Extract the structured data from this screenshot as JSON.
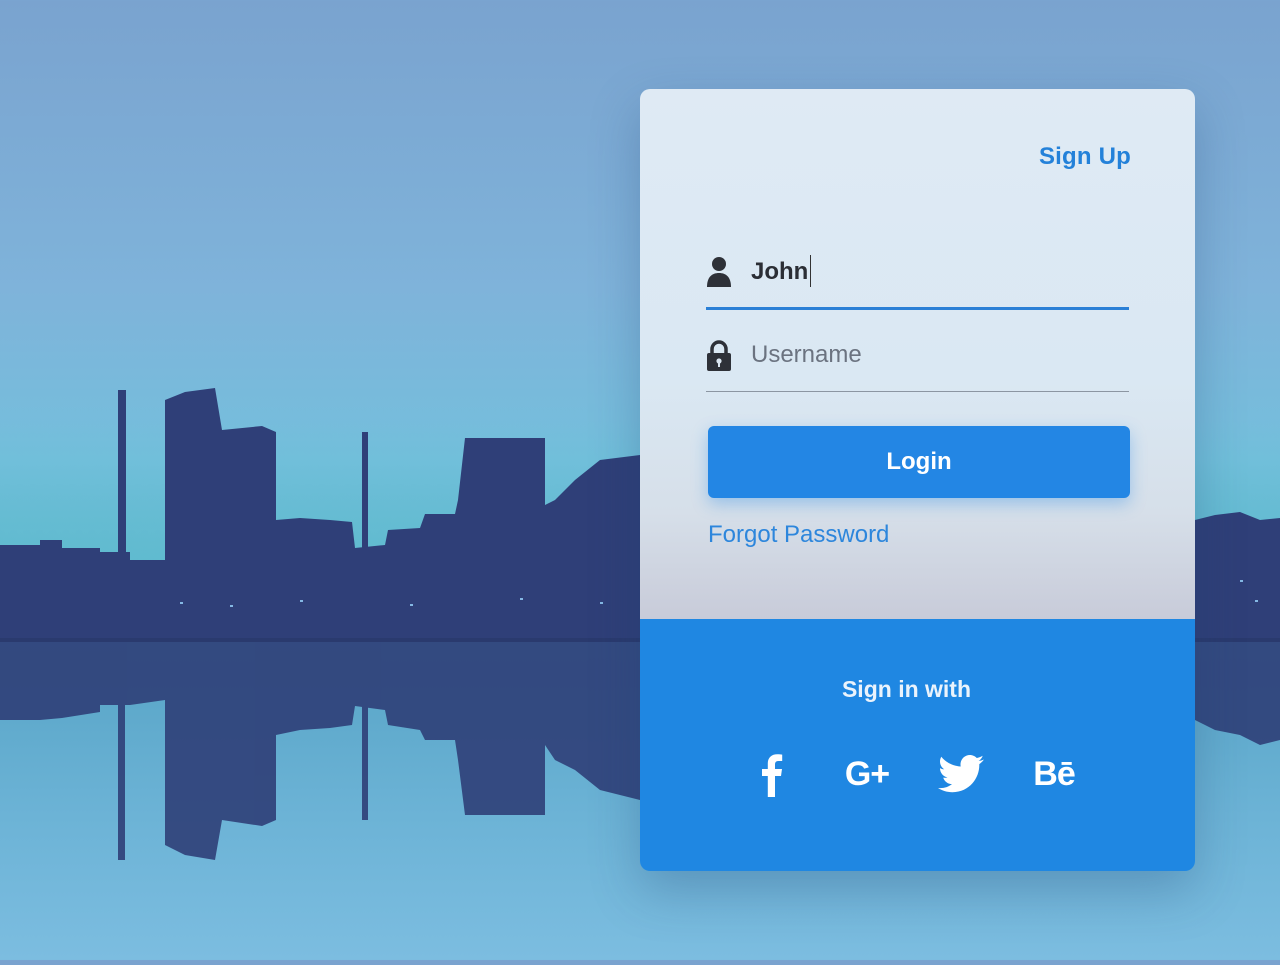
{
  "header": {
    "signup_label": "Sign Up"
  },
  "form": {
    "username_value": "John",
    "password_placeholder": "Username",
    "login_label": "Login",
    "forgot_label": "Forgot Password"
  },
  "social": {
    "heading": "Sign in with",
    "items": [
      {
        "name": "facebook",
        "icon": "facebook-icon"
      },
      {
        "name": "google-plus",
        "icon": "google-plus-icon",
        "glyph": "G+"
      },
      {
        "name": "twitter",
        "icon": "twitter-icon"
      },
      {
        "name": "behance",
        "icon": "behance-icon",
        "glyph": "Bē"
      }
    ]
  },
  "colors": {
    "accent": "#1f87e2",
    "button": "#2386e4",
    "link": "#2381d9",
    "skyline": "#2e3f78"
  }
}
